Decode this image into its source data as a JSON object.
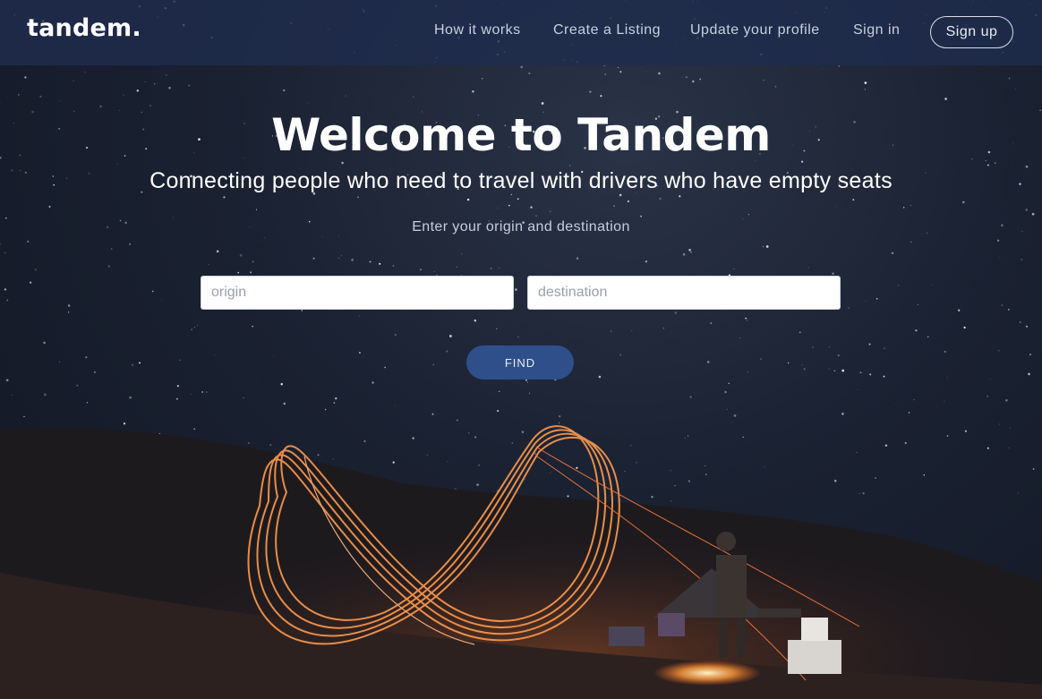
{
  "nav": {
    "logo": "tandem.",
    "links": [
      "How it works",
      "Create a Listing",
      "Update your profile",
      "Sign in"
    ],
    "signup_label": "Sign up"
  },
  "hero": {
    "title": "Welcome to Tandem",
    "subtitle": "Connecting people who need to travel with drivers who have empty seats",
    "prompt": "Enter your origin and destination"
  },
  "search": {
    "origin_placeholder": "origin",
    "destination_placeholder": "destination",
    "origin_value": "",
    "destination_value": "",
    "find_label": "FIND"
  },
  "colors": {
    "navbar": "#1f2c4d",
    "accent_button": "#2f4f8a",
    "light_trail": "#ff8a3d"
  }
}
